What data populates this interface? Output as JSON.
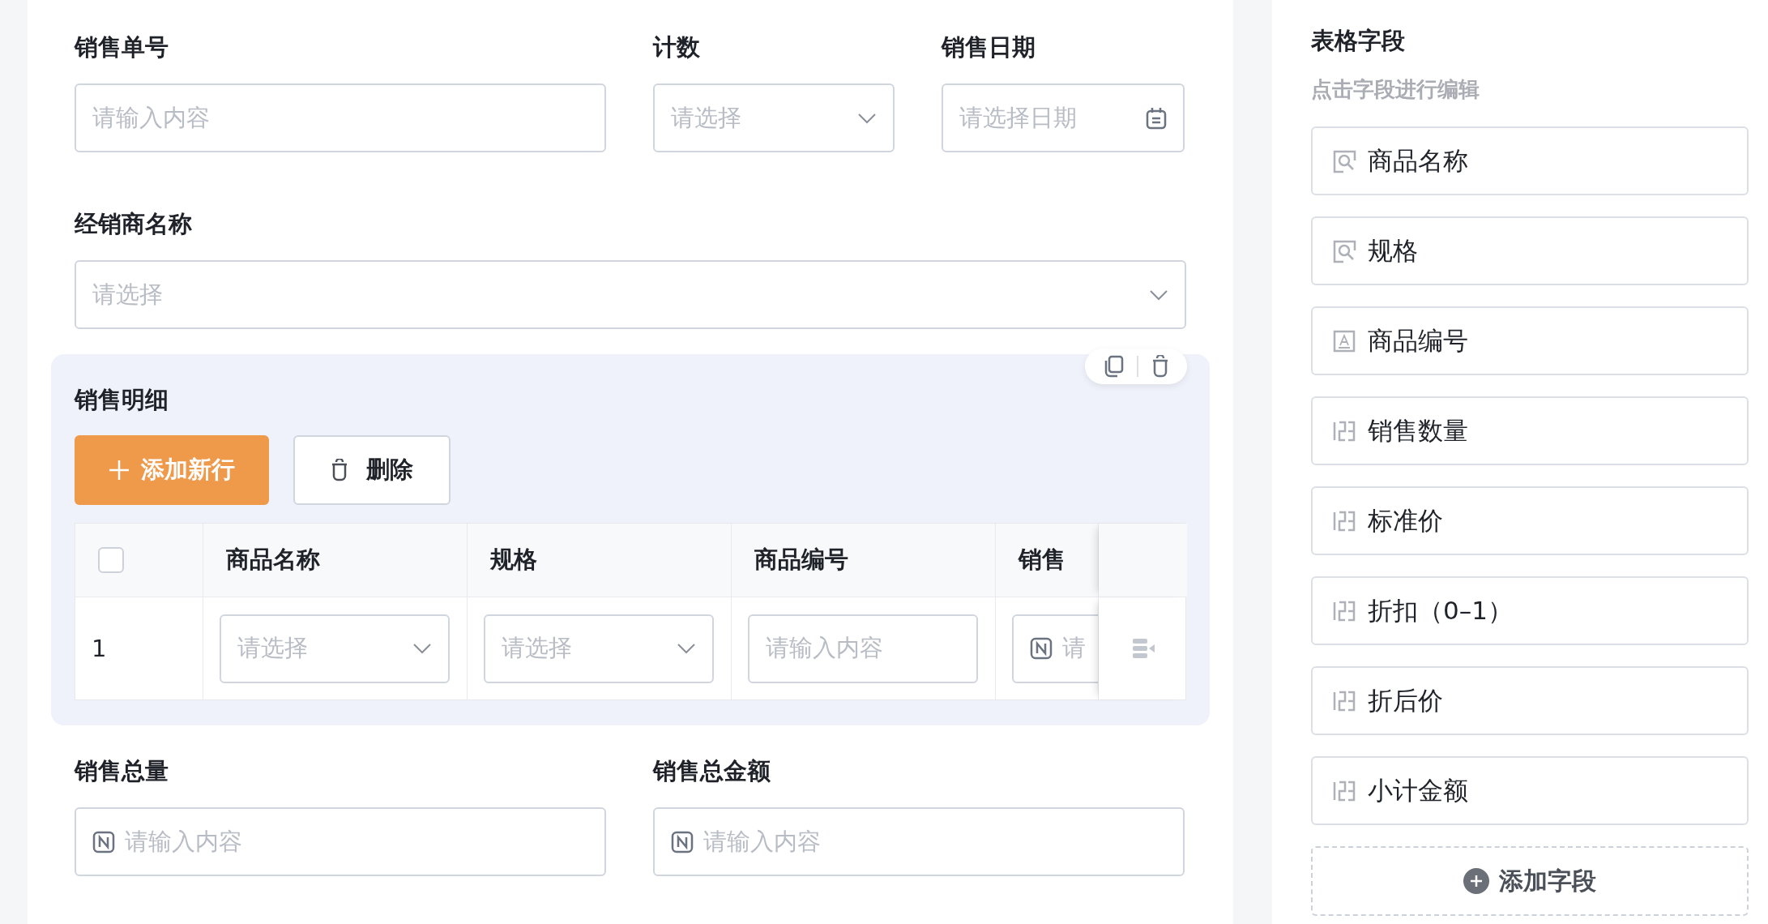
{
  "form": {
    "row_1": [
      {
        "label": "销售单号",
        "kind": "text",
        "placeholder": "请输入内容"
      },
      {
        "label": "计数",
        "kind": "select",
        "placeholder": "请选择"
      },
      {
        "label": "销售日期",
        "kind": "date",
        "placeholder": "请选择日期"
      }
    ],
    "row_2": [
      {
        "label": "经销商名称",
        "kind": "select",
        "placeholder": "请选择"
      }
    ],
    "detail": {
      "title": "销售明细",
      "buttons": [
        {
          "label": "添加新行",
          "kind": "primary"
        },
        {
          "label": "删除",
          "kind": "delete"
        }
      ],
      "table": {
        "select_all": {
          "checked": false
        },
        "columns": [
          "商品名称",
          "规格",
          "商品编号",
          "销售"
        ],
        "rows": [
          {
            "index": "1",
            "cells": [
              {
                "kind": "select",
                "placeholder": "请选择"
              },
              {
                "kind": "select",
                "placeholder": "请选择"
              },
              {
                "kind": "text",
                "placeholder": "请输入内容"
              },
              {
                "kind": "number",
                "placeholder": "请"
              }
            ]
          }
        ]
      }
    },
    "row_3": [
      {
        "label": "销售总量",
        "kind": "number",
        "placeholder": "请输入内容"
      },
      {
        "label": "销售总金额",
        "kind": "number",
        "placeholder": "请输入内容"
      }
    ]
  },
  "sidebar": {
    "title": "表格字段",
    "subtitle": "点击字段进行编辑",
    "items": [
      {
        "label": "商品名称",
        "kind": "lookup"
      },
      {
        "label": "规格",
        "kind": "lookup"
      },
      {
        "label": "商品编号",
        "kind": "text"
      },
      {
        "label": "销售数量",
        "kind": "number"
      },
      {
        "label": "标准价",
        "kind": "number"
      },
      {
        "label": "折扣（0–1）",
        "kind": "number"
      },
      {
        "label": "折后价",
        "kind": "number"
      },
      {
        "label": "小计金额",
        "kind": "number"
      }
    ],
    "add_button": "添加字段"
  }
}
